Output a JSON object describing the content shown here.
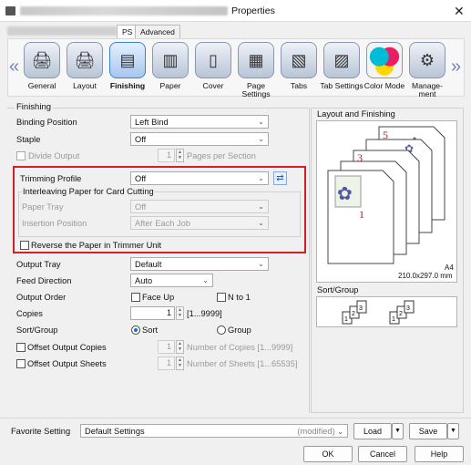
{
  "window": {
    "title": "Properties",
    "close": "✕"
  },
  "tabs": [
    {
      "label": "PS"
    },
    {
      "label": "Advanced"
    }
  ],
  "ribbon": [
    {
      "label": "General",
      "icon": "printer-general-icon"
    },
    {
      "label": "Layout",
      "icon": "printer-layout-icon"
    },
    {
      "label": "Finishing",
      "icon": "finishing-icon"
    },
    {
      "label": "Paper",
      "icon": "paper-icon"
    },
    {
      "label": "Cover",
      "icon": "cover-icon"
    },
    {
      "label": "Page Settings",
      "icon": "page-settings-icon"
    },
    {
      "label": "Tabs",
      "icon": "tabs-icon"
    },
    {
      "label": "Tab Settings",
      "icon": "tab-settings-icon"
    },
    {
      "label": "Color Mode",
      "icon": "color-mode-icon"
    },
    {
      "label": "Manage-ment",
      "icon": "management-icon"
    }
  ],
  "section": "Finishing",
  "binding": {
    "label": "Binding Position",
    "value": "Left Bind"
  },
  "staple": {
    "label": "Staple",
    "value": "Off"
  },
  "divide": {
    "label": "Divide Output",
    "count": "1",
    "unit": "Pages per Section"
  },
  "trimming": {
    "label": "Trimming Profile",
    "value": "Off"
  },
  "interleave": {
    "title": "Interleaving Paper for Card Cutting",
    "tray_label": "Paper Tray",
    "tray_value": "Off",
    "pos_label": "Insertion Position",
    "pos_value": "After Each Job"
  },
  "reverse": {
    "label": "Reverse the Paper in Trimmer Unit"
  },
  "output_tray": {
    "label": "Output Tray",
    "value": "Default"
  },
  "feed": {
    "label": "Feed Direction",
    "value": "Auto"
  },
  "order": {
    "label": "Output Order",
    "faceup": "Face Up",
    "nto1": "N to 1"
  },
  "copies": {
    "label": "Copies",
    "value": "1",
    "range": "[1...9999]"
  },
  "sortgroup": {
    "label": "Sort/Group",
    "sort": "Sort",
    "group": "Group"
  },
  "offset_copies": {
    "label": "Offset Output Copies",
    "count": "1",
    "unit": "Number of Copies [1...9999]"
  },
  "offset_sheets": {
    "label": "Offset Output Sheets",
    "count": "1",
    "unit": "Number of Sheets [1...65535]"
  },
  "preview": {
    "title": "Layout and Finishing",
    "paper": "A4",
    "size": "210.0x297.0 mm",
    "pages": [
      "5",
      "4",
      "3",
      "2",
      "1"
    ]
  },
  "sort_panel": {
    "title": "Sort/Group",
    "pages": [
      "1",
      "2",
      "3",
      "1",
      "2",
      "3"
    ]
  },
  "favorite": {
    "label": "Favorite Setting",
    "value": "Default Settings",
    "modified": "(modified)",
    "load": "Load",
    "save": "Save"
  },
  "footer": {
    "ok": "OK",
    "cancel": "Cancel",
    "help": "Help"
  }
}
